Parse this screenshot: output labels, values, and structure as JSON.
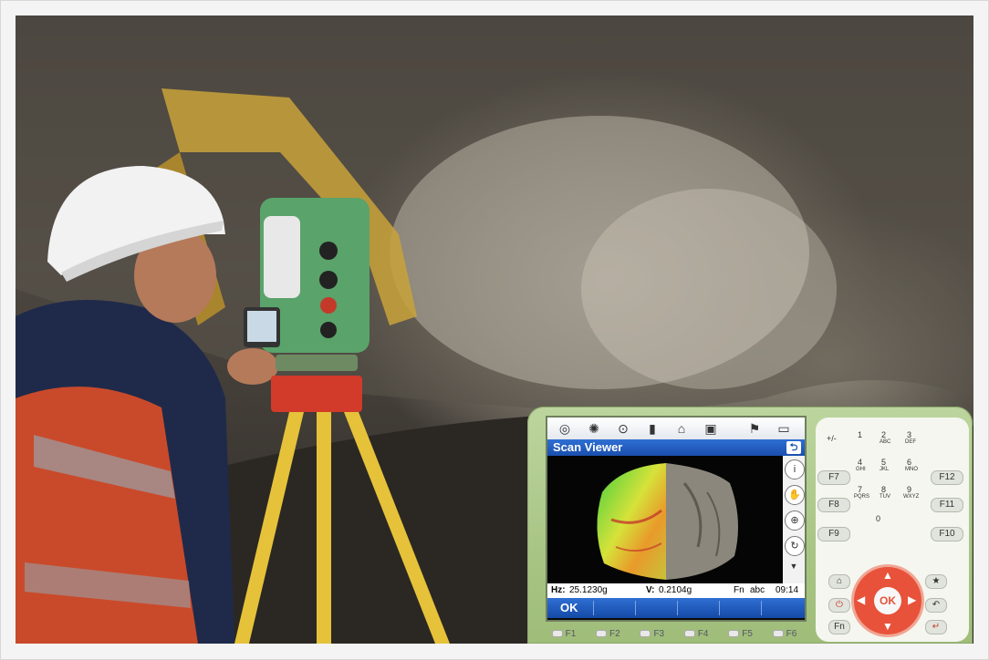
{
  "screen": {
    "title": "Scan Viewer",
    "back_label": "⮌",
    "status": {
      "hz_label": "Hz:",
      "hz_value": "25.1230g",
      "v_label": "V:",
      "v_value": "0.2104g",
      "mode": "Fn",
      "input": "abc",
      "time": "09:14"
    },
    "ok_label": "OK",
    "toolbar_icons": [
      "target-icon",
      "laser-icon",
      "level-icon",
      "info-icon",
      "prism-icon",
      "camera-icon",
      "flag-icon",
      "battery-icon"
    ]
  },
  "fkeys": [
    "F1",
    "F2",
    "F3",
    "F4",
    "F5",
    "F6"
  ],
  "side_keys_left": [
    "F7",
    "F8",
    "F9"
  ],
  "side_keys_right": [
    "F12",
    "F11",
    "F10"
  ],
  "keypad": {
    "plusminus": "+/-",
    "k1": "1",
    "k2": "2",
    "k2sub": "ABC",
    "k3": "3",
    "k3sub": "DEF",
    "k4": "4",
    "k4sub": "GHI",
    "k5": "5",
    "k5sub": "JKL",
    "k6": "6",
    "k6sub": "MNO",
    "k7": "7",
    "k7sub": "PQRS",
    "k8": "8",
    "k8sub": "TUV",
    "k9": "9",
    "k9sub": "WXYZ",
    "k0": "0",
    "ok": "OK",
    "fn": "Fn"
  },
  "colors": {
    "accent_blue": "#1a4fae",
    "controller_green": "#a9c585",
    "dpad_red": "#e8523a",
    "helmet_white": "#f2f2f2",
    "tripod_yellow": "#e6c23a"
  }
}
